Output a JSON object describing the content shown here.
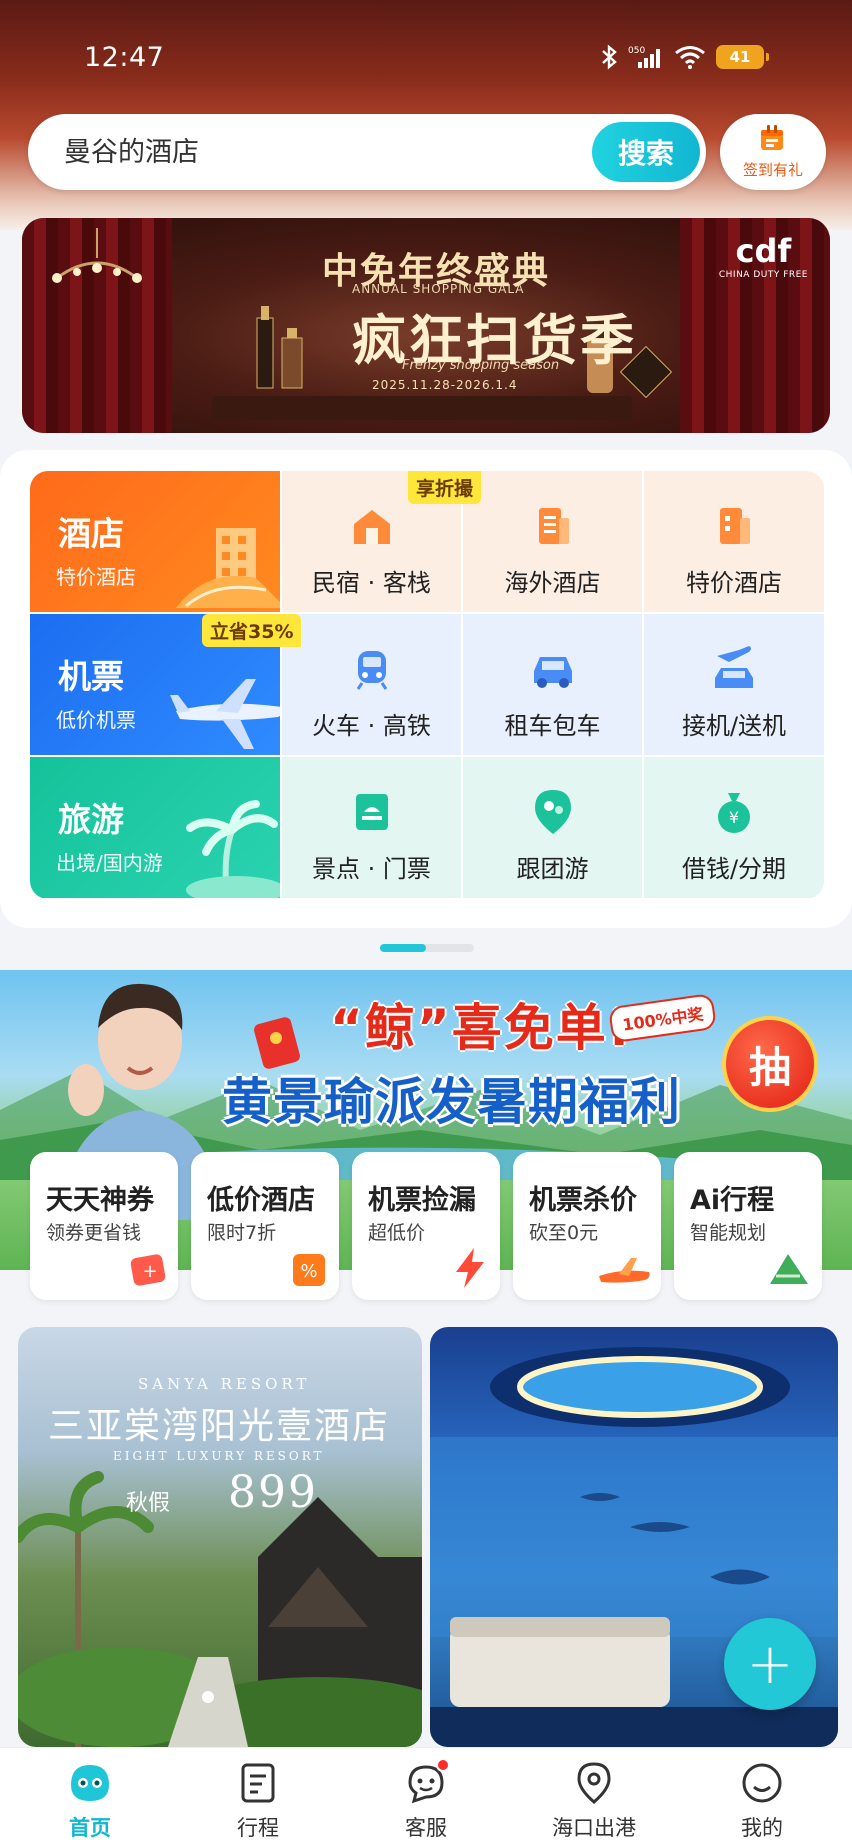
{
  "status_bar": {
    "time": "12:47",
    "network": "050",
    "battery": "41"
  },
  "search": {
    "value": "曼谷的酒店",
    "button_label": "搜索"
  },
  "checkin": {
    "label": "签到有礼",
    "icon": "gift-calendar-icon"
  },
  "ad_banner": {
    "title": "中免年终盛典",
    "subtitle_en": "ANNUAL SHOPPING GALA",
    "headline": "疯狂扫货季",
    "script": "Frenzy shopping season",
    "date_range": "2025.11.28-2026.1.4",
    "brand": "cdf",
    "brand_sub": "CHINA DUTY FREE"
  },
  "categories": {
    "rows": [
      {
        "main": {
          "title": "酒店",
          "subtitle": "特价酒店",
          "icon": "hotel-building-icon",
          "color": "#ff6a1a"
        },
        "items": [
          {
            "label": "民宿 · 客栈",
            "icon": "homestay-icon"
          },
          {
            "label": "海外酒店",
            "icon": "overseas-hotel-icon"
          },
          {
            "label": "特价酒店",
            "icon": "discount-hotel-icon"
          }
        ]
      },
      {
        "main": {
          "title": "机票",
          "subtitle": "低价机票",
          "icon": "airplane-icon",
          "color": "#1c6ef0"
        },
        "items": [
          {
            "label": "火车 · 高铁",
            "icon": "train-icon"
          },
          {
            "label": "租车包车",
            "icon": "car-rental-icon"
          },
          {
            "label": "接机/送机",
            "icon": "airport-transfer-icon"
          }
        ]
      },
      {
        "main": {
          "title": "旅游",
          "subtitle": "出境/国内游",
          "icon": "palm-island-icon",
          "color": "#14c29a"
        },
        "items": [
          {
            "label": "景点 · 门票",
            "icon": "ticket-icon"
          },
          {
            "label": "跟团游",
            "icon": "group-tour-pin-icon"
          },
          {
            "label": "借钱/分期",
            "icon": "money-bag-icon"
          }
        ]
      }
    ],
    "tag_discount": "享折撮",
    "tag_save": "立省35%"
  },
  "pager": {
    "pages": 2,
    "active": 1
  },
  "promo": {
    "title_1": "“鲸”喜免单!",
    "title_2": "黄景瑜派发暑期福利",
    "badge": "100%中奖",
    "draw_label": "抽",
    "tiles": [
      {
        "title": "天天神券",
        "subtitle": "领券更省钱",
        "icon": "coupon-icon"
      },
      {
        "title": "低价酒店",
        "subtitle": "限时7折",
        "icon": "percent-tag-icon"
      },
      {
        "title": "机票捡漏",
        "subtitle": "超低价",
        "icon": "lightning-icon"
      },
      {
        "title": "机票杀价",
        "subtitle": "砍至0元",
        "icon": "plane-toy-icon"
      },
      {
        "title": "Ai行程",
        "subtitle": "智能规划",
        "icon": "zongzi-icon"
      }
    ]
  },
  "feed": {
    "left": {
      "resort_en": "SANYA RESORT",
      "name": "三亚棠湾阳光壹酒店",
      "en2": "EIGHT LUXURY RESORT",
      "price_prefix": "秋假",
      "price": "899"
    },
    "right": {
      "image": "aquarium-suite"
    }
  },
  "fab": {
    "label": "+"
  },
  "tabs": [
    {
      "label": "首页",
      "icon": "home-mascot-icon",
      "active": true
    },
    {
      "label": "行程",
      "icon": "itinerary-icon",
      "active": false
    },
    {
      "label": "客服",
      "icon": "customer-service-icon",
      "active": false,
      "badge": true
    },
    {
      "label": "海口出港",
      "icon": "location-pin-icon",
      "active": false
    },
    {
      "label": "我的",
      "icon": "profile-smile-icon",
      "active": false
    }
  ]
}
